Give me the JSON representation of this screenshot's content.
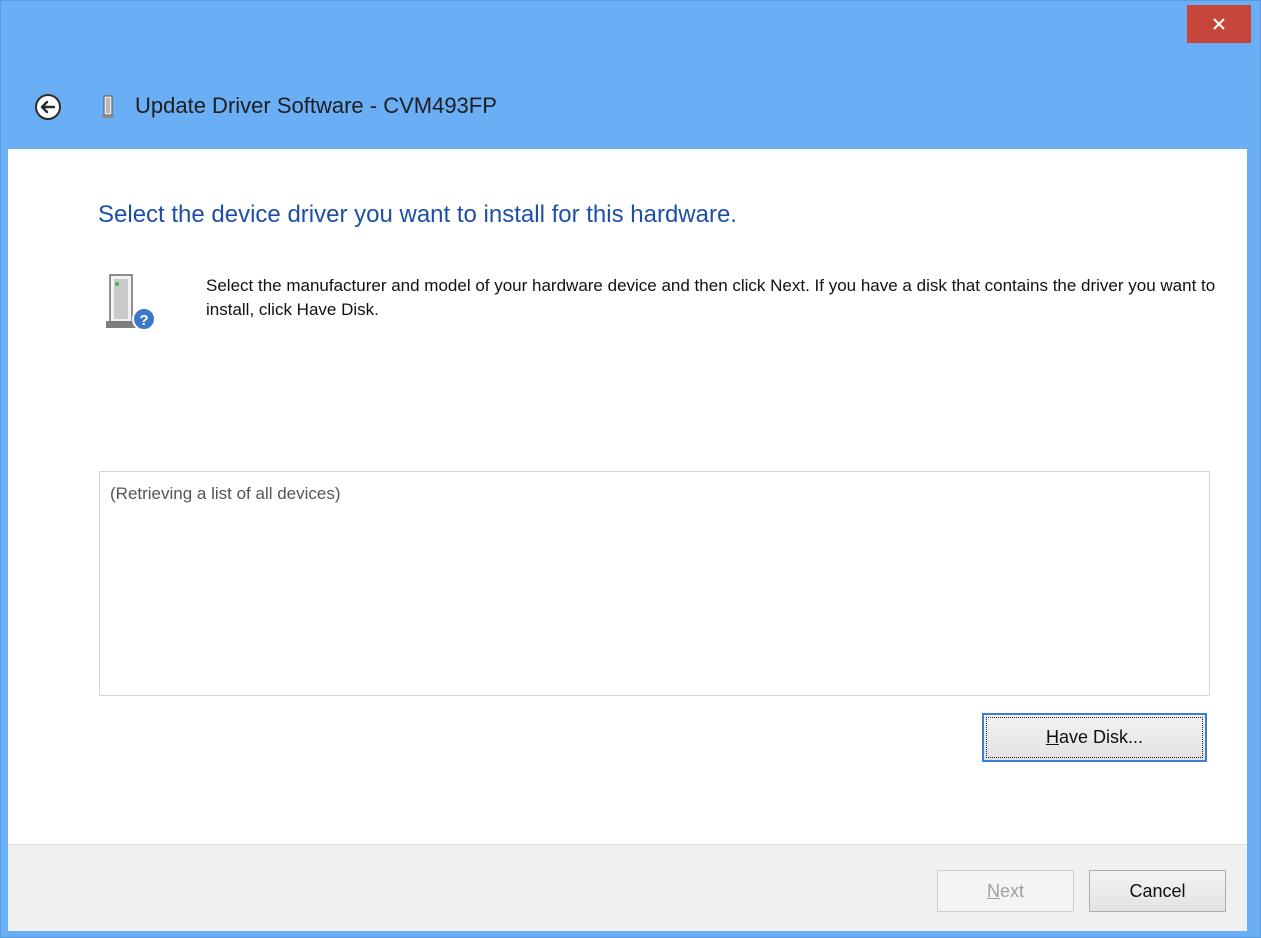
{
  "window": {
    "title": "Update Driver Software - CVM493FP",
    "frame_color": "#6aaef5",
    "close_color": "#c7453a"
  },
  "title_bar": {
    "close_icon": "close-icon",
    "back_icon": "back-arrow-icon",
    "device_icon": "monitor-device-icon"
  },
  "main": {
    "heading": "Select the device driver you want to install for this hardware.",
    "heading_color": "#1e4fa8",
    "description": "Select the manufacturer and model of your hardware device and then click Next. If you have a disk that contains the driver you want to install, click Have Disk.",
    "description_icon": "hardware-question-icon",
    "list_status": "(Retrieving a list of all devices)",
    "have_disk": {
      "mnemonic": "H",
      "rest": "ave Disk..."
    }
  },
  "footer": {
    "next": {
      "mnemonic": "N",
      "rest": "ext",
      "enabled": false
    },
    "cancel": "Cancel"
  }
}
